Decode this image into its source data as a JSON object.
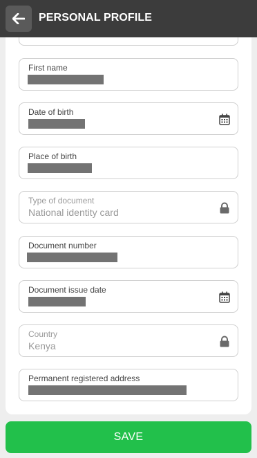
{
  "header": {
    "title": "PERSONAL PROFILE",
    "back_icon": "arrow-left-icon"
  },
  "form": {
    "fields": [
      {
        "label": "",
        "value": "",
        "state": "partially-visible"
      },
      {
        "label": "First name",
        "value": "",
        "state": "redacted"
      },
      {
        "label": "Date of birth",
        "value": "",
        "state": "redacted",
        "icon": "calendar-icon"
      },
      {
        "label": "Place of birth",
        "value": "",
        "state": "redacted"
      },
      {
        "label": "Type of document",
        "value": "National identity card",
        "state": "locked",
        "icon": "lock-icon"
      },
      {
        "label": "Document number",
        "value": "",
        "state": "redacted"
      },
      {
        "label": "Document issue date",
        "value": "",
        "state": "redacted",
        "icon": "calendar-icon"
      },
      {
        "label": "Country",
        "value": "Kenya",
        "state": "locked",
        "icon": "lock-icon"
      },
      {
        "label": "Permanent registered address",
        "value": "",
        "state": "redacted"
      }
    ]
  },
  "footer": {
    "save_label": "SAVE"
  },
  "colors": {
    "header_bg": "#3c3c3c",
    "accent": "#22c04b",
    "background": "#eeeeee",
    "redaction": "#737373"
  }
}
